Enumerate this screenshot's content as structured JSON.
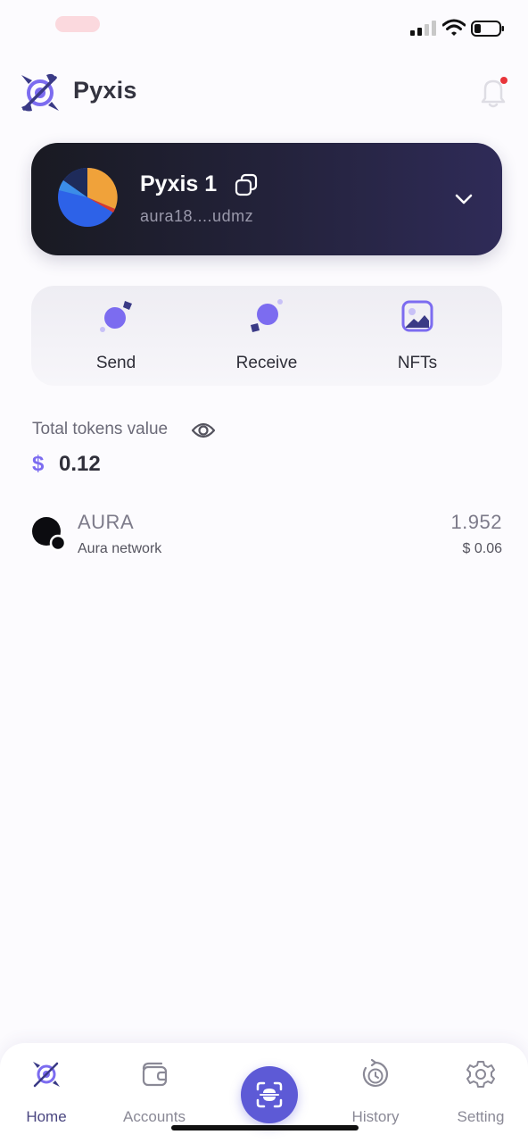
{
  "status_bar": {
    "icons": [
      "cellular-signal-icon",
      "wifi-icon",
      "battery-icon"
    ]
  },
  "header": {
    "title": "Pyxis",
    "logo_icon": "pyxis-logo",
    "notification_icon": "bell-icon",
    "has_notification_dot": true
  },
  "account": {
    "name": "Pyxis 1",
    "address": "aura18....udmz",
    "avatar": "pie-avatar-icon",
    "copy_icon": "copy-icon",
    "expand_icon": "chevron-down-icon"
  },
  "actions": [
    {
      "label": "Send",
      "icon": "send-icon"
    },
    {
      "label": "Receive",
      "icon": "receive-icon"
    },
    {
      "label": "NFTs",
      "icon": "image-icon"
    }
  ],
  "total": {
    "label": "Total tokens value",
    "currency_symbol": "$",
    "value": "0.12",
    "visibility_icon": "eye-icon"
  },
  "tokens": [
    {
      "symbol": "AURA",
      "network": "Aura network",
      "amount": "1.952",
      "value": "$ 0.06",
      "icon": "aura-token-icon"
    }
  ],
  "bottom_nav": {
    "items": [
      {
        "label": "Home",
        "icon": "pyxis-home-icon",
        "active": true
      },
      {
        "label": "Accounts",
        "icon": "wallet-icon",
        "active": false
      },
      {
        "label": "History",
        "icon": "history-icon",
        "active": false
      },
      {
        "label": "Setting",
        "icon": "gear-icon",
        "active": false
      }
    ],
    "scan_icon": "scan-icon"
  },
  "colors": {
    "accent": "#7c6cf0",
    "card_dark": "#1d1c2b",
    "scan_button": "#5d5ad6",
    "notification_dot": "#e8343a"
  }
}
